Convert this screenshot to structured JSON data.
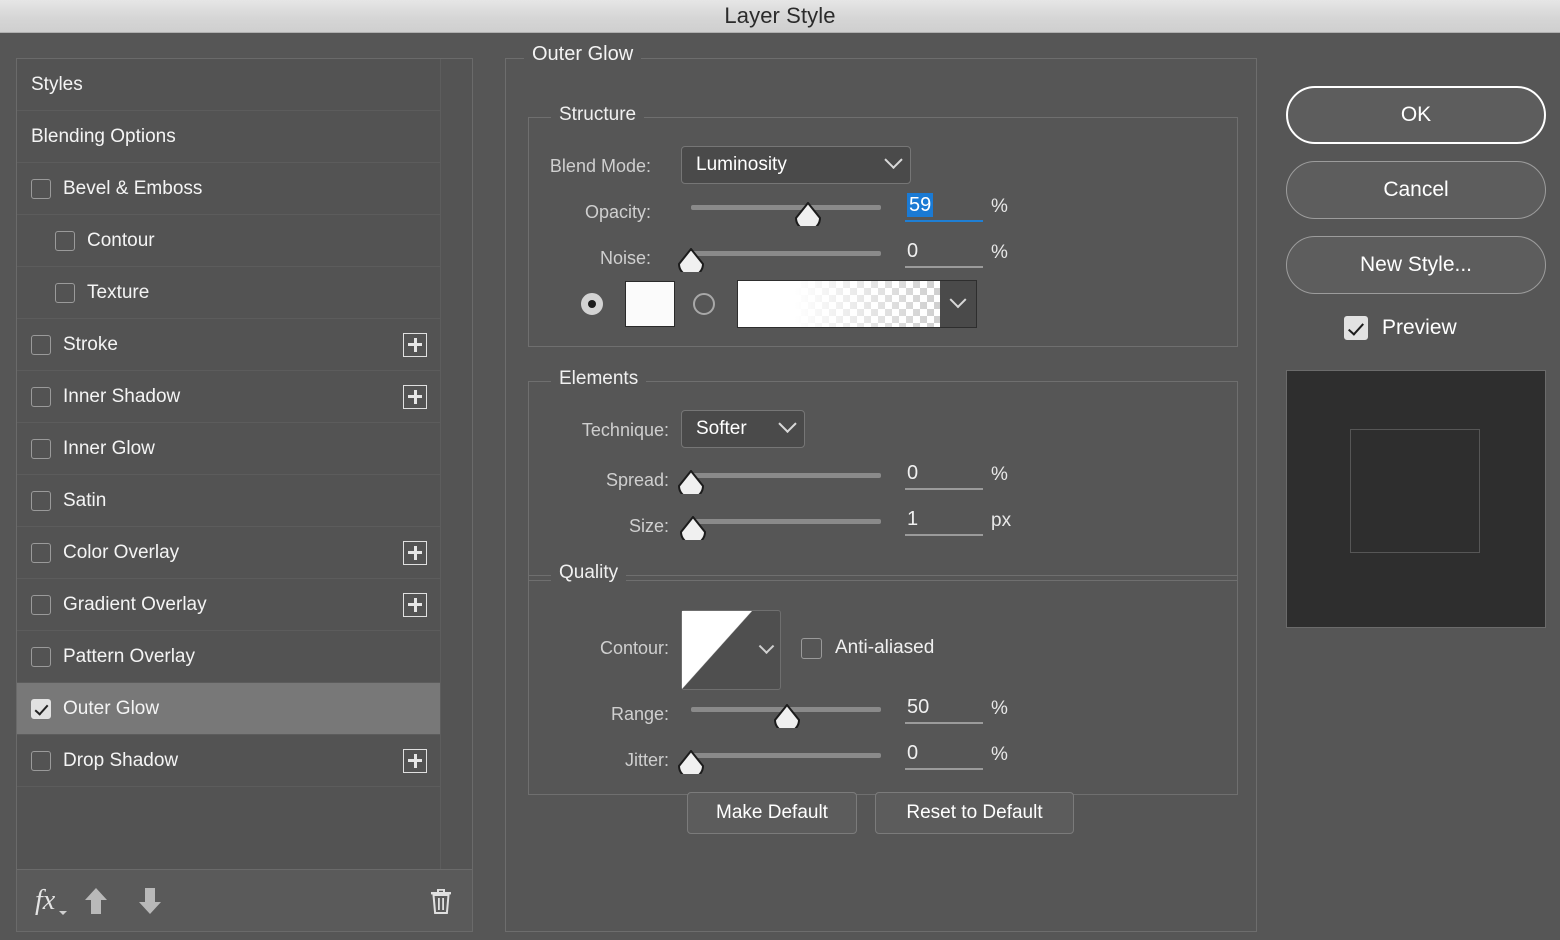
{
  "window": {
    "title": "Layer Style"
  },
  "sidebar": {
    "items": [
      {
        "label": "Styles",
        "type": "header",
        "checkbox": false,
        "checked": false,
        "indent": false,
        "plus": false,
        "selected": false
      },
      {
        "label": "Blending Options",
        "type": "header",
        "checkbox": false,
        "checked": false,
        "indent": false,
        "plus": false,
        "selected": false
      },
      {
        "label": "Bevel & Emboss",
        "type": "effect",
        "checkbox": true,
        "checked": false,
        "indent": false,
        "plus": false,
        "selected": false
      },
      {
        "label": "Contour",
        "type": "effect",
        "checkbox": true,
        "checked": false,
        "indent": true,
        "plus": false,
        "selected": false
      },
      {
        "label": "Texture",
        "type": "effect",
        "checkbox": true,
        "checked": false,
        "indent": true,
        "plus": false,
        "selected": false
      },
      {
        "label": "Stroke",
        "type": "effect",
        "checkbox": true,
        "checked": false,
        "indent": false,
        "plus": true,
        "selected": false
      },
      {
        "label": "Inner Shadow",
        "type": "effect",
        "checkbox": true,
        "checked": false,
        "indent": false,
        "plus": true,
        "selected": false
      },
      {
        "label": "Inner Glow",
        "type": "effect",
        "checkbox": true,
        "checked": false,
        "indent": false,
        "plus": false,
        "selected": false
      },
      {
        "label": "Satin",
        "type": "effect",
        "checkbox": true,
        "checked": false,
        "indent": false,
        "plus": false,
        "selected": false
      },
      {
        "label": "Color Overlay",
        "type": "effect",
        "checkbox": true,
        "checked": false,
        "indent": false,
        "plus": true,
        "selected": false
      },
      {
        "label": "Gradient Overlay",
        "type": "effect",
        "checkbox": true,
        "checked": false,
        "indent": false,
        "plus": true,
        "selected": false
      },
      {
        "label": "Pattern Overlay",
        "type": "effect",
        "checkbox": true,
        "checked": false,
        "indent": false,
        "plus": false,
        "selected": false
      },
      {
        "label": "Outer Glow",
        "type": "effect",
        "checkbox": true,
        "checked": true,
        "indent": false,
        "plus": false,
        "selected": true
      },
      {
        "label": "Drop Shadow",
        "type": "effect",
        "checkbox": true,
        "checked": false,
        "indent": false,
        "plus": true,
        "selected": false
      }
    ],
    "toolbar": {
      "fx_icon": "fx",
      "fx_label": "fx-menu",
      "move_up_icon": "arrow-up-icon",
      "move_down_icon": "arrow-down-icon",
      "delete_icon": "trash-icon"
    }
  },
  "main": {
    "effect_title": "Outer Glow",
    "structure": {
      "legend": "Structure",
      "blend_mode_label": "Blend Mode:",
      "blend_mode_value": "Luminosity",
      "opacity_label": "Opacity:",
      "opacity_value": "59",
      "opacity_unit": "%",
      "opacity_percent": 59,
      "noise_label": "Noise:",
      "noise_value": "0",
      "noise_unit": "%",
      "noise_percent": 0,
      "fill_type": "color",
      "color_hex": "#FBFBFB",
      "gradient_name": "foreground-to-transparent"
    },
    "elements": {
      "legend": "Elements",
      "technique_label": "Technique:",
      "technique_value": "Softer",
      "spread_label": "Spread:",
      "spread_value": "0",
      "spread_unit": "%",
      "spread_percent": 0,
      "size_label": "Size:",
      "size_value": "1",
      "size_unit": "px",
      "size_percent": 0
    },
    "quality": {
      "legend": "Quality",
      "contour_label": "Contour:",
      "anti_aliased_label": "Anti-aliased",
      "anti_aliased_checked": false,
      "range_label": "Range:",
      "range_value": "50",
      "range_unit": "%",
      "range_percent": 50,
      "jitter_label": "Jitter:",
      "jitter_value": "0",
      "jitter_unit": "%",
      "jitter_percent": 0
    },
    "buttons": {
      "make_default": "Make Default",
      "reset_to_default": "Reset to Default"
    }
  },
  "actions": {
    "ok": "OK",
    "cancel": "Cancel",
    "new_style": "New Style...",
    "preview_label": "Preview",
    "preview_checked": true
  },
  "colors": {
    "dialog_bg": "#565656",
    "list_bg": "#535353",
    "selected_row": "#787878",
    "titlebar": "#D9D9D9",
    "accent_selection": "#1A7AD4",
    "text_primary": "#F4F4F4",
    "text_label": "#CFCFCF"
  }
}
